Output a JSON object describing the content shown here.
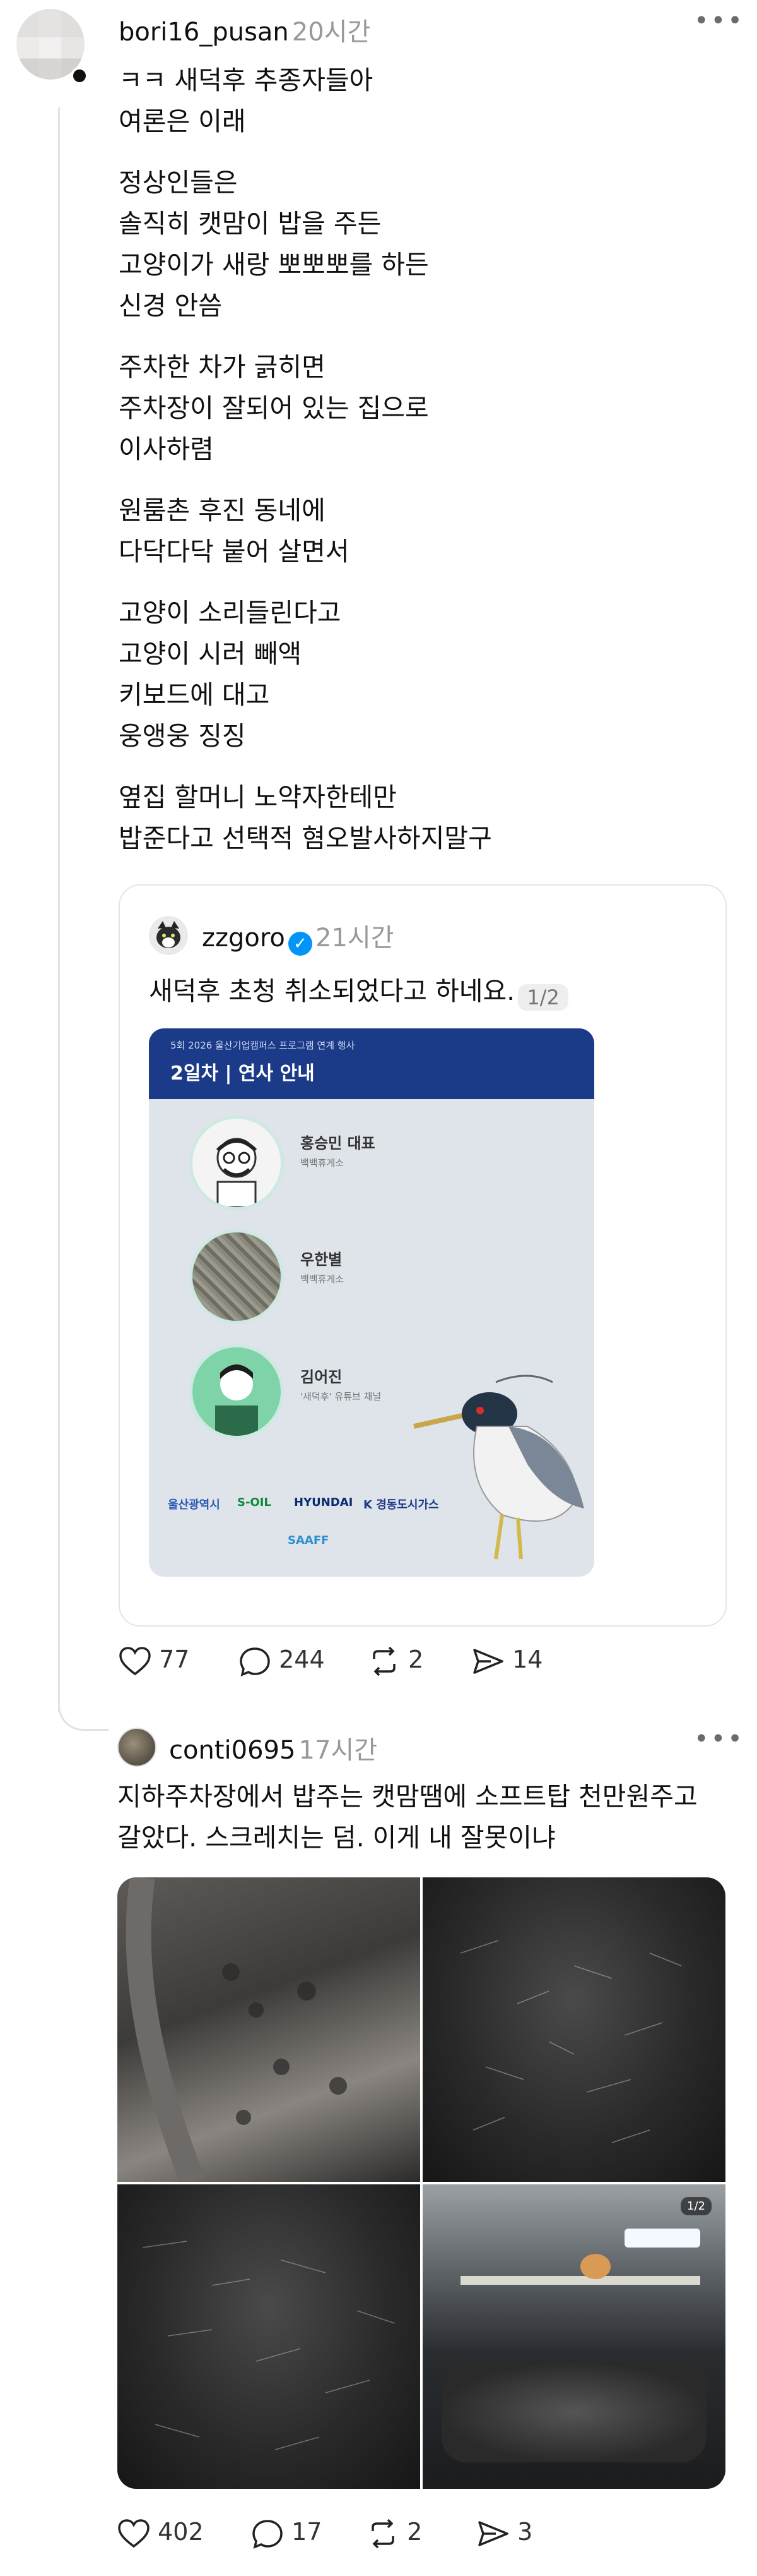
{
  "post1": {
    "username": "bori16_pusan",
    "time": "20시간",
    "paragraphs": [
      "ㅋㅋ 새덕후 추종자들아\n여론은 이래",
      "정상인들은\n솔직히 캣맘이 밥을 주든\n고양이가 새랑 뽀뽀뽀를 하든\n신경 안씀",
      "주차한 차가 긁히면\n주차장이 잘되어 있는 집으로\n이사하렴",
      "원룸촌 후진 동네에\n다닥다닥 붙어 살면서",
      "고양이 소리들린다고\n고양이 시러 빼액\n키보드에 대고\n웅앵웅 징징",
      "옆집 할머니 노약자한테만\n밥준다고 선택적 혐오발사하지말구"
    ],
    "likes": "77",
    "replies": "244",
    "reposts": "2",
    "shares": "14"
  },
  "quote": {
    "username": "zzgoro",
    "time": "21시간",
    "text": "새덕후 초청 취소되었다고 하네요.",
    "page": "1/2",
    "poster": {
      "subtitle": "5회 2026 울산기업캠퍼스 프로그램 연계 행사",
      "title": "2일차 | 연사 안내",
      "speakers": [
        {
          "name": "홍승민 대표",
          "affiliation": "백백휴게소"
        },
        {
          "name": "우한별",
          "affiliation": "백백휴게소"
        },
        {
          "name": "김어진",
          "affiliation": "'새덕후' 유튜브 채널"
        }
      ],
      "logos": [
        "울산광역시",
        "S-OIL",
        "HYUNDAI",
        "K 경동도시가스",
        "SAAFF"
      ]
    }
  },
  "post2": {
    "username": "conti0695",
    "time": "17시간",
    "text": "지하주차장에서 밥주는 캣맘땜에 소프트탑 천만원주고\n갈았다. 스크레치는 덤. 이게 내 잘못이냐",
    "image_page": "1/2",
    "likes": "402",
    "replies": "17",
    "reposts": "2",
    "shares": "3"
  },
  "colors": {
    "verified": "#0095f6",
    "poster_header": "#1b3a88",
    "meta_gray": "#999999"
  },
  "icons": [
    "heart-icon",
    "comment-icon",
    "repost-icon",
    "share-icon",
    "more-icon",
    "verified-icon"
  ]
}
